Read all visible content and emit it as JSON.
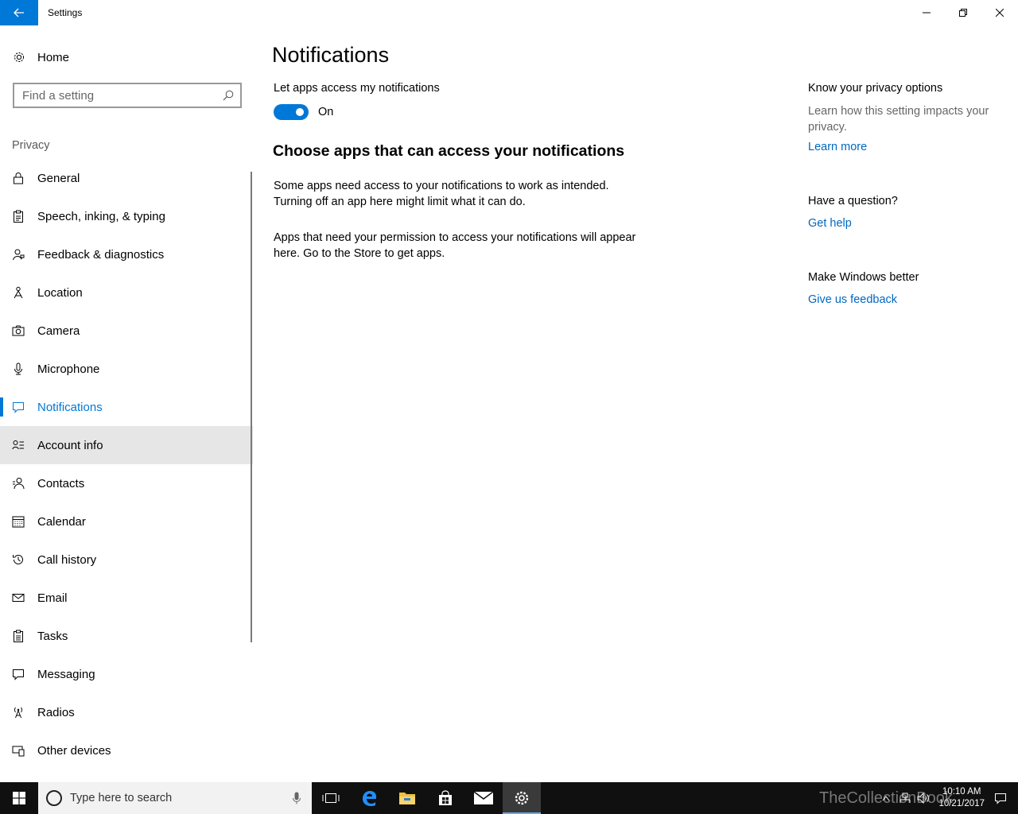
{
  "window": {
    "title": "Settings"
  },
  "sidebar": {
    "home_label": "Home",
    "search_placeholder": "Find a setting",
    "section_title": "Privacy",
    "items": [
      {
        "label": "General",
        "icon": "lock-icon"
      },
      {
        "label": "Speech, inking, & typing",
        "icon": "clipboard-icon"
      },
      {
        "label": "Feedback & diagnostics",
        "icon": "person-feedback-icon"
      },
      {
        "label": "Location",
        "icon": "location-icon"
      },
      {
        "label": "Camera",
        "icon": "camera-icon"
      },
      {
        "label": "Microphone",
        "icon": "microphone-icon"
      },
      {
        "label": "Notifications",
        "icon": "notification-icon",
        "active": true
      },
      {
        "label": "Account info",
        "icon": "account-info-icon",
        "hover": true
      },
      {
        "label": "Contacts",
        "icon": "contacts-icon"
      },
      {
        "label": "Calendar",
        "icon": "calendar-icon"
      },
      {
        "label": "Call history",
        "icon": "history-icon"
      },
      {
        "label": "Email",
        "icon": "mail-icon"
      },
      {
        "label": "Tasks",
        "icon": "tasks-icon"
      },
      {
        "label": "Messaging",
        "icon": "message-icon"
      },
      {
        "label": "Radios",
        "icon": "radio-tower-icon"
      },
      {
        "label": "Other devices",
        "icon": "devices-icon"
      }
    ]
  },
  "main": {
    "title": "Notifications",
    "toggle_label": "Let apps access my notifications",
    "toggle_state": "On",
    "subheading": "Choose apps that can access your notifications",
    "para1": "Some apps need access to your notifications to work as intended. Turning off an app here might limit what it can do.",
    "para2": "Apps that need your permission to access your notifications will appear here. Go to the Store to get apps."
  },
  "aside": {
    "privacy_heading": "Know your privacy options",
    "privacy_text": "Learn how this setting impacts your privacy.",
    "learn_more": "Learn more",
    "question_heading": "Have a question?",
    "get_help": "Get help",
    "better_heading": "Make Windows better",
    "feedback": "Give us feedback"
  },
  "taskbar": {
    "search_placeholder": "Type here to search",
    "time": "10:10 AM",
    "date": "10/21/2017",
    "watermark": "TheCollectionBook"
  },
  "colors": {
    "accent": "#0078d7",
    "link": "#0067c0",
    "taskbar": "#101010"
  }
}
